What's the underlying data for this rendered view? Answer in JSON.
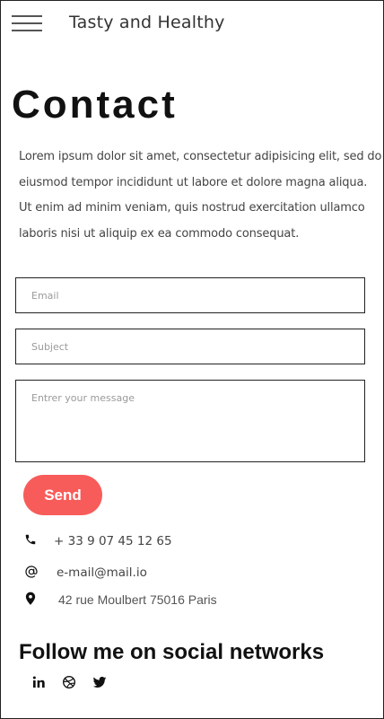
{
  "header": {
    "brand": "Tasty and Healthy",
    "menu_icon": "hamburger-menu-icon"
  },
  "page": {
    "title": "Contact"
  },
  "intro": {
    "lines": [
      "Lorem ipsum dolor sit amet, consectetur adipisicing elit, sed do",
      "eiusmod tempor incididunt ut labore et dolore magna aliqua.",
      "Ut enim ad minim veniam, quis nostrud exercitation ullamco",
      "laboris nisi ut aliquip ex ea commodo consequat."
    ]
  },
  "form": {
    "email_placeholder": "Email",
    "email_value": "",
    "subject_placeholder": "Subject",
    "subject_value": "",
    "message_placeholder": "Entrer your message",
    "message_value": "",
    "send_label": "Send"
  },
  "contact_info": {
    "phone": "+ 33 9 07 45 12 65",
    "email": "e-mail@mail.io",
    "address": "42 rue Moulbert 75016 Paris",
    "icons": [
      "phone-icon",
      "at-sign-icon",
      "map-pin-icon"
    ]
  },
  "social": {
    "title": "Follow me on social networks",
    "icons": [
      "linkedin-icon",
      "dribbble-icon",
      "twitter-icon"
    ]
  },
  "colors": {
    "accent": "#f75c5a",
    "text_dark": "#111111",
    "text_body": "#444444",
    "border": "#222222"
  }
}
